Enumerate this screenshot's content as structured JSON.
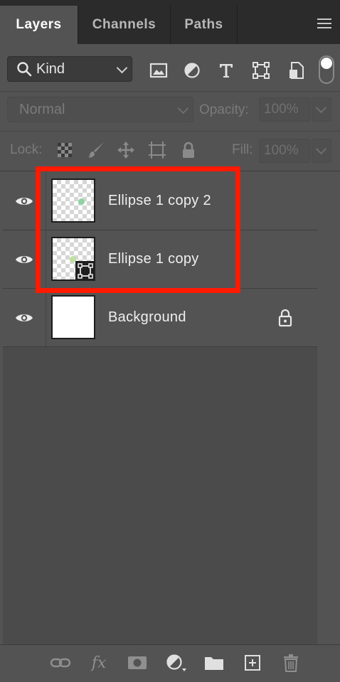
{
  "tabs": [
    {
      "label": "Layers",
      "active": true
    },
    {
      "label": "Channels",
      "active": false
    },
    {
      "label": "Paths",
      "active": false
    }
  ],
  "panel_menu_icon": "hamburger-icon",
  "filter": {
    "kind_label": "Kind",
    "icons": [
      "pixel-layer-filter-icon",
      "adjustment-layer-filter-icon",
      "type-layer-filter-icon",
      "shape-layer-filter-icon",
      "smart-object-filter-icon"
    ],
    "toggle_on": true
  },
  "blend": {
    "mode": "Normal",
    "opacity_label": "Opacity:",
    "opacity_value": "100%"
  },
  "lock": {
    "label": "Lock:",
    "icons": [
      "lock-transparent-pixels-icon",
      "lock-image-pixels-icon",
      "lock-position-icon",
      "lock-artboard-icon",
      "lock-all-icon"
    ],
    "fill_label": "Fill:",
    "fill_value": "100%"
  },
  "layers": [
    {
      "name": "Ellipse 1 copy 2",
      "visible": true,
      "thumb": "transparent",
      "dot_color": "#8fd3a2",
      "smart_object": false,
      "locked": false
    },
    {
      "name": "Ellipse 1 copy",
      "visible": true,
      "thumb": "transparent",
      "dot_color": "#bfe0a0",
      "smart_object": true,
      "locked": false
    },
    {
      "name": "Background",
      "visible": true,
      "thumb": "white",
      "smart_object": false,
      "locked": true
    }
  ],
  "highlight_color": "#ff1a00",
  "bottom_icons": [
    "link-layers-icon",
    "fx-icon",
    "add-mask-icon",
    "new-adjustment-layer-icon",
    "new-group-icon",
    "new-layer-icon",
    "delete-layer-icon"
  ],
  "fx_text": "fx"
}
